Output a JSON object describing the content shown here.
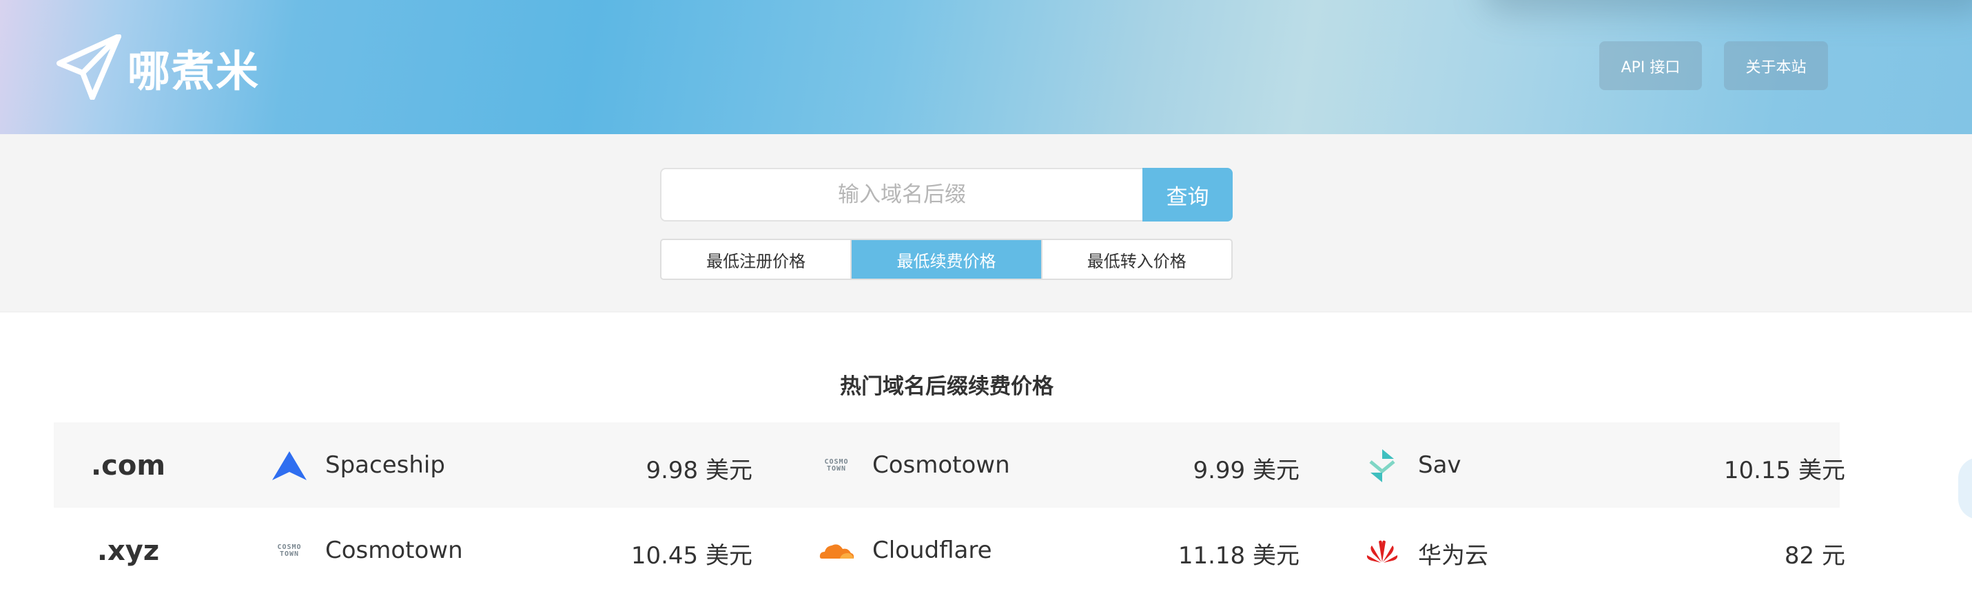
{
  "header": {
    "brand": "哪煮米",
    "logo_icon": "paper-plane-icon",
    "nav": [
      {
        "label": "API 接口"
      },
      {
        "label": "关于本站"
      }
    ]
  },
  "search": {
    "placeholder": "输入域名后缀",
    "button_label": "查询",
    "tabs": [
      {
        "label": "最低注册价格",
        "active": false
      },
      {
        "label": "最低续费价格",
        "active": true
      },
      {
        "label": "最低转入价格",
        "active": false
      }
    ]
  },
  "section": {
    "title": "热门域名后缀续费价格",
    "rows": [
      {
        "tld": ".com",
        "offers": [
          {
            "provider": "Spaceship",
            "icon": "spaceship-icon",
            "price": "9.98 美元"
          },
          {
            "provider": "Cosmotown",
            "icon": "cosmotown-icon",
            "icon_text": [
              "COSMO",
              "TOWN"
            ],
            "price": "9.99 美元"
          },
          {
            "provider": "Sav",
            "icon": "sav-icon",
            "price": "10.15 美元"
          }
        ]
      },
      {
        "tld": ".xyz",
        "offers": [
          {
            "provider": "Cosmotown",
            "icon": "cosmotown-icon",
            "icon_text": [
              "COSMO",
              "TOWN"
            ],
            "price": "10.45 美元"
          },
          {
            "provider": "Cloudflare",
            "icon": "cloudflare-icon",
            "price": "11.18 美元"
          },
          {
            "provider": "华为云",
            "icon": "huawei-icon",
            "price": "82 元"
          }
        ]
      }
    ]
  },
  "colors": {
    "accent": "#62bbe5",
    "header_text": "#ffffff",
    "row_alt_bg": "#f7f7f7",
    "spaceship_blue": "#2f6ef0",
    "cloudflare_orange": "#f48120",
    "huawei_red": "#e02020",
    "sav_teal": "#3fbfbf"
  }
}
